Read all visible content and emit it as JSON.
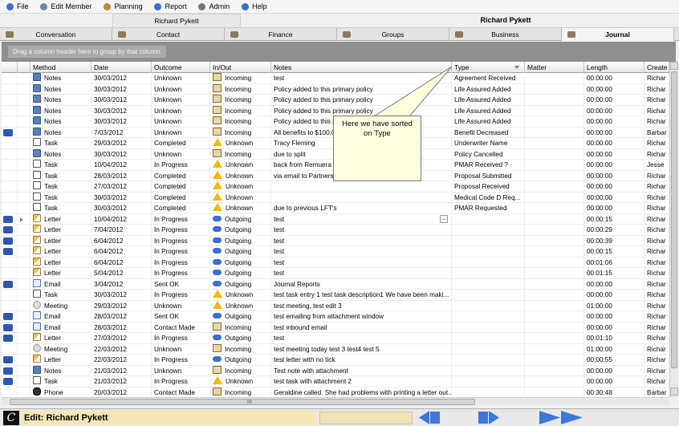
{
  "menu": [
    {
      "label": "File",
      "icon": "file-icon"
    },
    {
      "label": "Edit Member",
      "icon": "edit-member-icon"
    },
    {
      "label": "Planning",
      "icon": "planning-icon"
    },
    {
      "label": "Report",
      "icon": "report-icon"
    },
    {
      "label": "Admin",
      "icon": "admin-icon"
    },
    {
      "label": "Help",
      "icon": "help-icon"
    }
  ],
  "titles": {
    "left": "Richard Pykett",
    "right": "Richard Pykett"
  },
  "tabs": [
    {
      "label": "Conversation",
      "icon": "conversation-icon",
      "active": false
    },
    {
      "label": "Contact",
      "icon": "contact-icon",
      "active": false
    },
    {
      "label": "Finance",
      "icon": "finance-icon",
      "active": false
    },
    {
      "label": "Groups",
      "icon": "groups-icon",
      "active": false
    },
    {
      "label": "Business",
      "icon": "business-icon",
      "active": false
    },
    {
      "label": "Journal",
      "icon": "journal-icon",
      "active": true
    }
  ],
  "group_hint": "Drag a column header here to group by that column.",
  "columns": [
    "Method",
    "Date",
    "Outcome",
    "In/Out",
    "Notes",
    "Type",
    "Matter",
    "Length",
    "Create"
  ],
  "sorted_column": "Type",
  "rows": [
    {
      "flag": false,
      "method": "Notes",
      "date": "30/03/2012",
      "outcome": "Unknown",
      "inout": "Incoming",
      "notes": "test",
      "type": "Agreement Received",
      "matter": "",
      "length": "00:00:00",
      "created": "Richar"
    },
    {
      "flag": false,
      "method": "Notes",
      "date": "30/03/2012",
      "outcome": "Unknown",
      "inout": "Incoming",
      "notes": "Policy added to this primary policy",
      "type": "Life Assured Added",
      "matter": "",
      "length": "00:00:00",
      "created": "Richar"
    },
    {
      "flag": false,
      "method": "Notes",
      "date": "30/03/2012",
      "outcome": "Unknown",
      "inout": "Incoming",
      "notes": "Policy added to this primary policy",
      "type": "Life Assured Added",
      "matter": "",
      "length": "00:00:00",
      "created": "Richar"
    },
    {
      "flag": false,
      "method": "Notes",
      "date": "30/03/2012",
      "outcome": "Unknown",
      "inout": "Incoming",
      "notes": "Policy added to this primary policy",
      "type": "Life Assured Added",
      "matter": "",
      "length": "00:00:00",
      "created": "Richar"
    },
    {
      "flag": false,
      "method": "Notes",
      "date": "30/03/2012",
      "outcome": "Unknown",
      "inout": "Incoming",
      "notes": "Policy added to this p",
      "type": "Life Assured Added",
      "matter": "",
      "length": "00:00:00",
      "created": "Richar"
    },
    {
      "flag": true,
      "method": "Notes",
      "date": "7/03/2012",
      "outcome": "Unknown",
      "inout": "Incoming",
      "notes": "All benefits to $100,0",
      "type": "Benefit Decreased",
      "matter": "",
      "length": "00:00:00",
      "created": "Barbar"
    },
    {
      "flag": false,
      "method": "Task",
      "date": "29/03/2012",
      "outcome": "Completed",
      "inout": "Unknown",
      "notes": "Tracy Fleming",
      "type": "Underwriter Name",
      "matter": "",
      "length": "00:00:00",
      "created": "Richar"
    },
    {
      "flag": false,
      "method": "Notes",
      "date": "30/03/2012",
      "outcome": "Unknown",
      "inout": "Incoming",
      "notes": "due to split",
      "type": "Policy Cancelled",
      "matter": "",
      "length": "00:00:00",
      "created": "Richar"
    },
    {
      "flag": false,
      "method": "Task",
      "date": "10/04/2012",
      "outcome": "In Progress",
      "inout": "Unknown",
      "notes": "back from Remuera",
      "type": "PMAR Received ?",
      "matter": "",
      "length": "00:00:00",
      "created": "Jesse"
    },
    {
      "flag": false,
      "method": "Task",
      "date": "28/03/2012",
      "outcome": "Completed",
      "inout": "Unknown",
      "notes": "via email to Partners",
      "type": "Proposal Submitted",
      "matter": "",
      "length": "00:00:00",
      "created": "Richar"
    },
    {
      "flag": false,
      "method": "Task",
      "date": "27/03/2012",
      "outcome": "Completed",
      "inout": "Unknown",
      "notes": "",
      "type": "Proposal Received",
      "matter": "",
      "length": "00:00:00",
      "created": "Richar"
    },
    {
      "flag": false,
      "method": "Task",
      "date": "30/03/2012",
      "outcome": "Completed",
      "inout": "Unknown",
      "notes": "",
      "type": "Medical Code D Req...",
      "matter": "",
      "length": "00:00:00",
      "created": "Richar"
    },
    {
      "flag": false,
      "method": "Task",
      "date": "30/03/2012",
      "outcome": "Completed",
      "inout": "Unknown",
      "notes": "due to previous LFT's",
      "type": "PMAR Requested",
      "matter": "",
      "length": "00:00:00",
      "created": "Richar"
    },
    {
      "flag": true,
      "current": true,
      "method": "Letter",
      "date": "10/04/2012",
      "outcome": "In Progress",
      "inout": "Outgoing",
      "notes": "test",
      "type": "",
      "matter": "",
      "length": "00:00:15",
      "created": "Richar"
    },
    {
      "flag": true,
      "method": "Letter",
      "date": "7/04/2012",
      "outcome": "In Progress",
      "inout": "Outgoing",
      "notes": "test",
      "type": "",
      "matter": "",
      "length": "00:00:29",
      "created": "Richar"
    },
    {
      "flag": true,
      "method": "Letter",
      "date": "6/04/2012",
      "outcome": "In Progress",
      "inout": "Outgoing",
      "notes": "test",
      "type": "",
      "matter": "",
      "length": "00:00:39",
      "created": "Richar"
    },
    {
      "flag": true,
      "method": "Letter",
      "date": "6/04/2012",
      "outcome": "In Progress",
      "inout": "Outgoing",
      "notes": "test",
      "type": "",
      "matter": "",
      "length": "00:00:15",
      "created": "Richar"
    },
    {
      "flag": false,
      "method": "Letter",
      "date": "6/04/2012",
      "outcome": "In Progress",
      "inout": "Outgoing",
      "notes": "test",
      "type": "",
      "matter": "",
      "length": "00:01:06",
      "created": "Richar"
    },
    {
      "flag": false,
      "method": "Letter",
      "date": "5/04/2012",
      "outcome": "In Progress",
      "inout": "Outgoing",
      "notes": "test",
      "type": "",
      "matter": "",
      "length": "00:01:15",
      "created": "Richar"
    },
    {
      "flag": true,
      "method": "Email",
      "date": "3/04/2012",
      "outcome": "Sent OK",
      "inout": "Outgoing",
      "notes": "Journal Reports",
      "type": "",
      "matter": "",
      "length": "00:00:00",
      "created": "Richar"
    },
    {
      "flag": false,
      "method": "Task",
      "date": "30/03/2012",
      "outcome": "In Progress",
      "inout": "Unknown",
      "notes": "test task entry 1 test task description1  We have been maki...",
      "type": "",
      "matter": "",
      "length": "00:00:00",
      "created": "Richar"
    },
    {
      "flag": false,
      "method": "Meeting",
      "date": "29/03/2012",
      "outcome": "Unknown",
      "inout": "Unknown",
      "notes": "test meeting, test edit 3",
      "type": "",
      "matter": "",
      "length": "01:00:00",
      "created": "Richar"
    },
    {
      "flag": true,
      "method": "Email",
      "date": "28/03/2012",
      "outcome": "Sent OK",
      "inout": "Outgoing",
      "notes": "test emailing from attachment window",
      "type": "",
      "matter": "",
      "length": "00:00:00",
      "created": "Richar"
    },
    {
      "flag": true,
      "method": "Email",
      "date": "28/03/2012",
      "outcome": "Contact Made",
      "inout": "Incoming",
      "notes": "test inbound email",
      "type": "",
      "matter": "",
      "length": "00:00:00",
      "created": "Richar"
    },
    {
      "flag": true,
      "method": "Letter",
      "date": "27/03/2012",
      "outcome": "In Progress",
      "inout": "Outgoing",
      "notes": "test",
      "type": "",
      "matter": "",
      "length": "00:01:10",
      "created": "Richar"
    },
    {
      "flag": false,
      "method": "Meeting",
      "date": "22/03/2012",
      "outcome": "Unknown",
      "inout": "Incoming",
      "notes": "test meeting today test 3 test4 test 5",
      "type": "",
      "matter": "",
      "length": "01:00:00",
      "created": "Richar"
    },
    {
      "flag": true,
      "method": "Letter",
      "date": "22/03/2012",
      "outcome": "In Progress",
      "inout": "Outgoing",
      "notes": "test letter with no tick",
      "type": "",
      "matter": "",
      "length": "00:00:55",
      "created": "Richar"
    },
    {
      "flag": true,
      "method": "Notes",
      "date": "21/03/2012",
      "outcome": "Unknown",
      "inout": "Incoming",
      "notes": "Test note with attachment",
      "type": "",
      "matter": "",
      "length": "00:00:00",
      "created": "Richar"
    },
    {
      "flag": true,
      "method": "Task",
      "date": "21/03/2012",
      "outcome": "In Progress",
      "inout": "Unknown",
      "notes": "test task with attachment 2",
      "type": "",
      "matter": "",
      "length": "00:00:00",
      "created": "Richar"
    },
    {
      "flag": false,
      "method": "Phone",
      "date": "20/03/2012",
      "outcome": "Contact Made",
      "inout": "Incoming",
      "notes": "Geraldine called. She had problems with printing a letter out...",
      "type": "",
      "matter": "",
      "length": "00:30:48",
      "created": "Barbar"
    }
  ],
  "callout": {
    "line1": "Here we have sorted",
    "line2": "on Type"
  },
  "status": {
    "logo": "C",
    "edit": "Edit: Richard Pykett"
  },
  "hscroll_grip": "III",
  "colors": {
    "nav_blue": "#3b78d8",
    "status_bg": "#f6e6b8",
    "group_area": "#8f8f8f"
  }
}
